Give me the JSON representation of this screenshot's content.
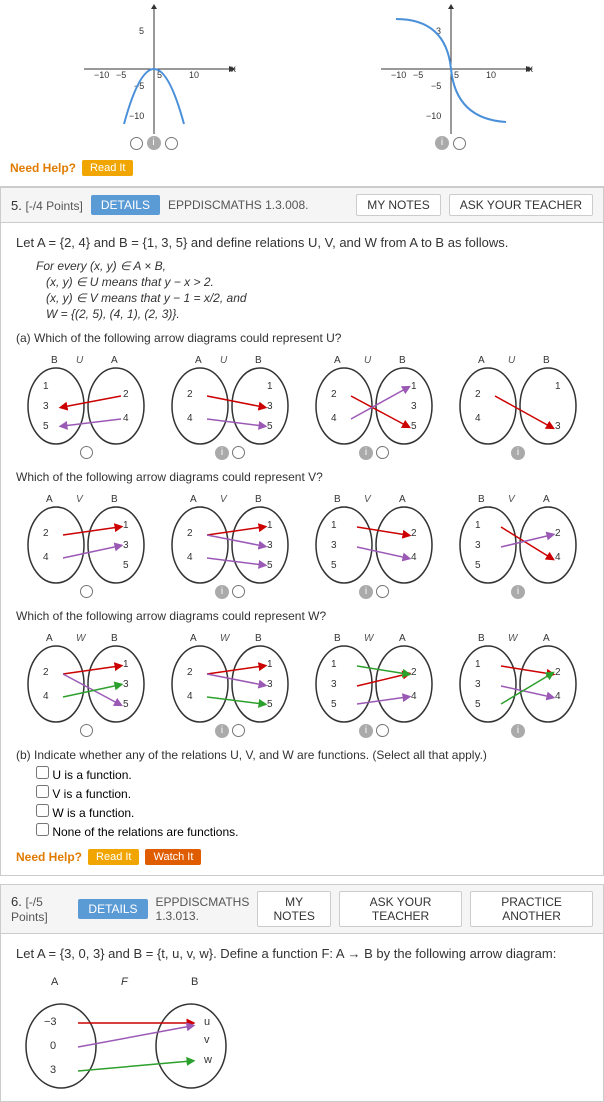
{
  "top_section": {
    "graph_note": "Graphs shown above",
    "need_help": "Need Help?",
    "read_it": "Read It"
  },
  "section5": {
    "number": "5.",
    "points": "[-/4 Points]",
    "details_label": "DETAILS",
    "code": "EPPDISCMATHS 1.3.008.",
    "my_notes_label": "MY NOTES",
    "ask_teacher_label": "ASK YOUR TEACHER",
    "problem_intro": "Let A = {2, 4} and B = {1, 3, 5} and define relations U, V, and W from A to B as follows.",
    "for_every": "For every (x, y) ∈ A × B,",
    "relation_u": "(x, y) ∈ U means that y − x > 2.",
    "relation_v": "(x, y) ∈ V means that y − 1 = x/2, and",
    "relation_w": "W = {(2, 5), (4, 1), (2, 3)}.",
    "question_a": "(a)  Which of the following arrow diagrams could represent U?",
    "question_v": "Which of the following arrow diagrams could represent V?",
    "question_w": "Which of the following arrow diagrams could represent W?",
    "question_b": "(b)  Indicate whether any of the relations U, V, and W are functions. (Select all that apply.)",
    "checkboxes": [
      "U is a function.",
      "V is a function.",
      "W is a function.",
      "None of the relations are functions."
    ],
    "need_help": "Need Help?",
    "read_it": "Read It",
    "watch_it": "Watch It"
  },
  "section6": {
    "number": "6.",
    "points": "[-/5 Points]",
    "details_label": "DETAILS",
    "code": "EPPDISCMATHS 1.3.013.",
    "my_notes_label": "MY NOTES",
    "ask_teacher_label": "ASK YOUR TEACHER",
    "practice_label": "PRACTICE ANOTHER",
    "problem_intro": "Let A = {3, 0, 3} and B = {t, u, v, w}. Define a function F: A → B by the following arrow diagram:",
    "diagram_label": "F"
  }
}
